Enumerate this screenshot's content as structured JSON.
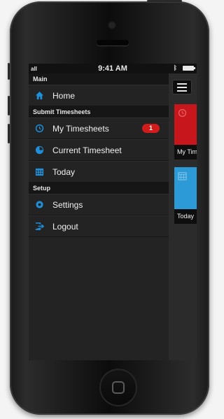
{
  "status_bar": {
    "signal": "all",
    "time": "9:41 AM"
  },
  "menu": {
    "sections": [
      {
        "header": "Main",
        "items": [
          {
            "label": "Home",
            "icon": "home-icon"
          }
        ]
      },
      {
        "header": "Submit Timesheets",
        "items": [
          {
            "label": "My Timesheets",
            "icon": "history-clock-icon",
            "badge": "1"
          },
          {
            "label": "Current Timesheet",
            "icon": "clock-pie-icon"
          },
          {
            "label": "Today",
            "icon": "calendar-icon"
          }
        ]
      },
      {
        "header": "Setup",
        "items": [
          {
            "label": "Settings",
            "icon": "gear-icon"
          },
          {
            "label": "Logout",
            "icon": "logout-icon"
          }
        ]
      }
    ]
  },
  "right_panel": {
    "tiles": [
      {
        "label": "My Tim",
        "color": "#c8161d"
      },
      {
        "label": "Today",
        "color": "#2b9ad6"
      }
    ]
  },
  "colors": {
    "accent_icon": "#1f8fd9",
    "badge": "#d21c1c"
  }
}
